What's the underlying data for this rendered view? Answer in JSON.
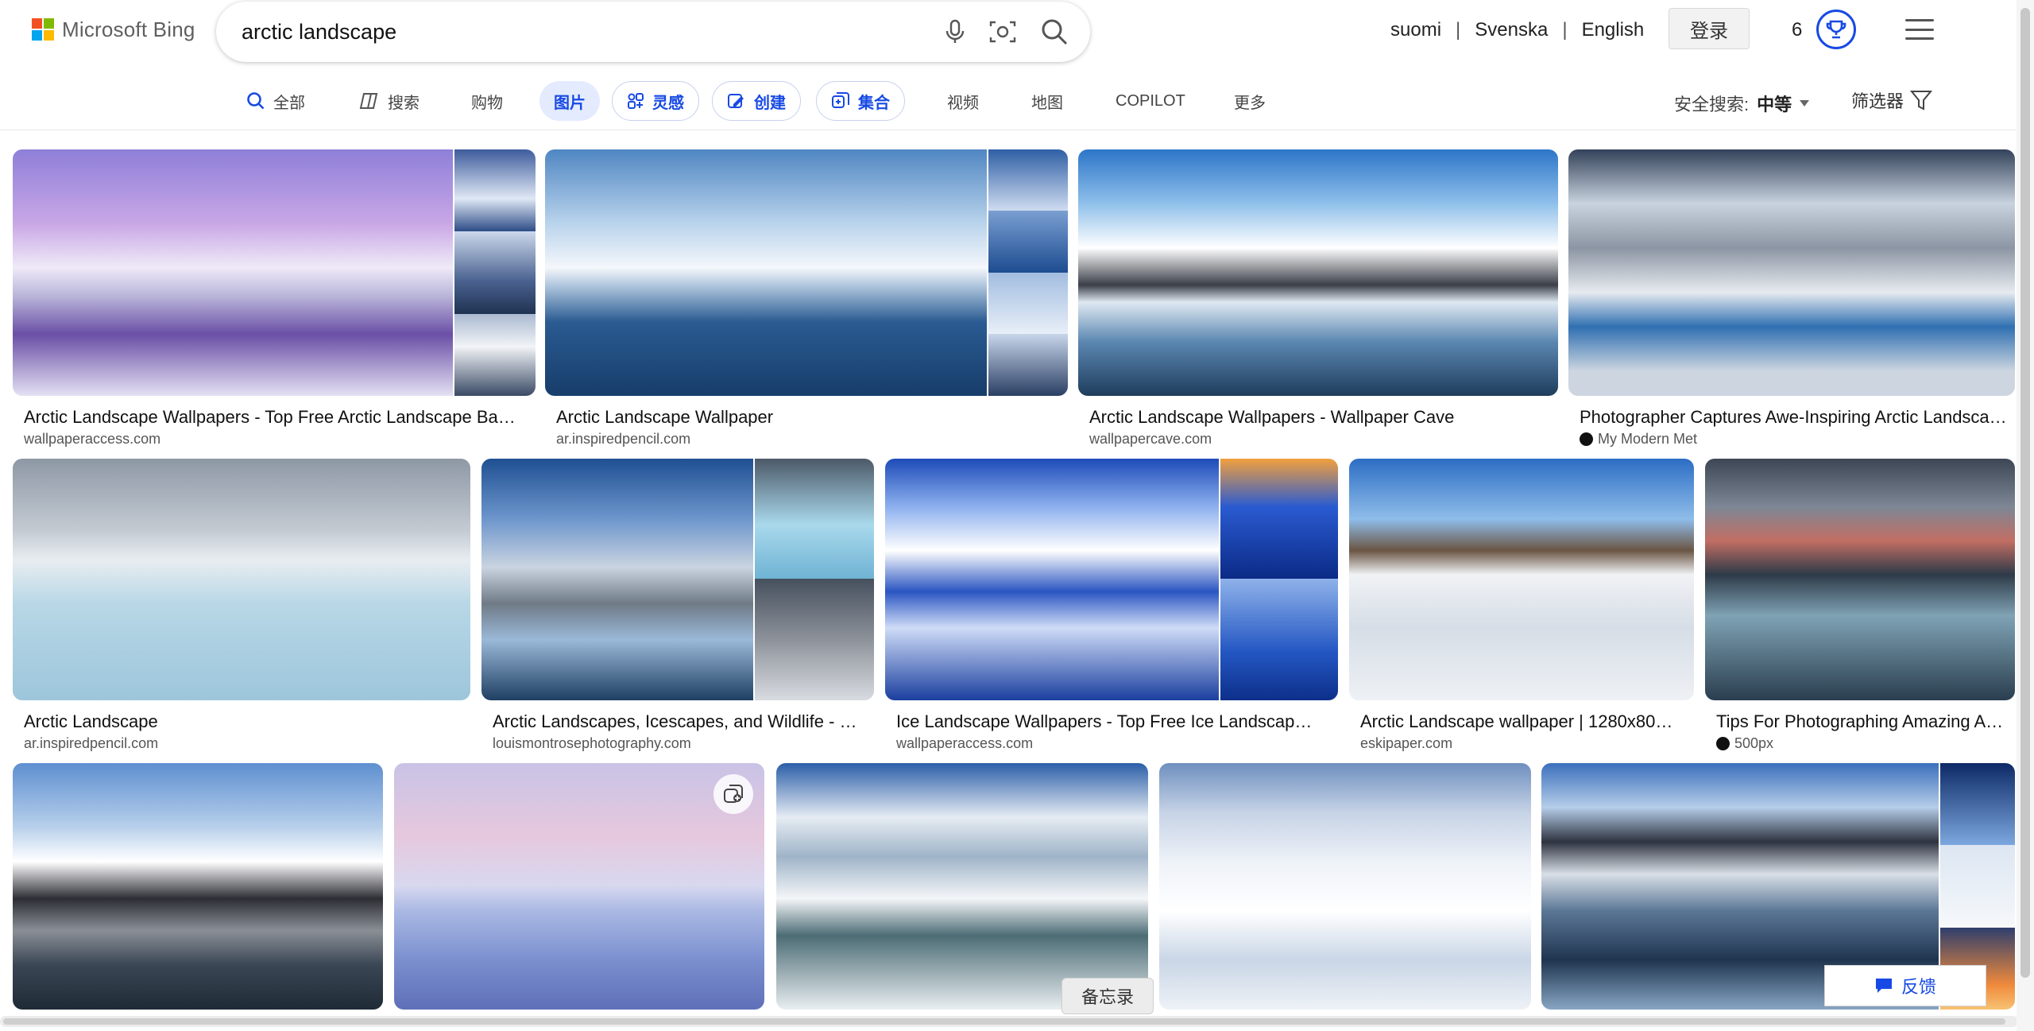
{
  "brand": {
    "name": "Microsoft Bing"
  },
  "search": {
    "query": "arctic landscape"
  },
  "header": {
    "languages": [
      "suomi",
      "Svenska",
      "English"
    ],
    "separator": "|",
    "login_label": "登录",
    "rewards_count": "6"
  },
  "nav": {
    "items": [
      {
        "label": "全部",
        "icon": "search-icon"
      },
      {
        "label": "搜索",
        "icon": "copilot-icon"
      },
      {
        "label": "购物"
      },
      {
        "label": "图片"
      },
      {
        "label": "灵感",
        "icon": "inspiration-icon"
      },
      {
        "label": "创建",
        "icon": "create-icon"
      },
      {
        "label": "集合",
        "icon": "collection-icon"
      },
      {
        "label": "视频"
      },
      {
        "label": "地图"
      },
      {
        "label": "COPILOT"
      },
      {
        "label": "更多"
      }
    ],
    "safe_search_label": "安全搜索:",
    "safe_search_value": "中等",
    "filter_label": "筛选器"
  },
  "results": [
    {
      "title": "Arctic Landscape Wallpapers - Top Free Arctic Landscape Ba…",
      "source": "wallpaperaccess.com"
    },
    {
      "title": "Arctic Landscape Wallpaper",
      "source": "ar.inspiredpencil.com"
    },
    {
      "title": "Arctic Landscape Wallpapers - Wallpaper Cave",
      "source": "wallpapercave.com"
    },
    {
      "title": "Photographer Captures Awe-Inspiring Arctic Landsca…",
      "source": "My Modern Met"
    },
    {
      "title": "Arctic Landscape",
      "source": "ar.inspiredpencil.com"
    },
    {
      "title": "Arctic Landscapes, Icescapes, and Wildlife - …",
      "source": "louismontrosephotography.com"
    },
    {
      "title": "Ice Landscape Wallpapers - Top Free Ice Landscap…",
      "source": "wallpaperaccess.com"
    },
    {
      "title": "Arctic Landscape wallpaper | 1280x80…",
      "source": "eskipaper.com"
    },
    {
      "title": "Tips For Photographing Amazing A…",
      "source": "500px"
    }
  ],
  "footer": {
    "memo_label": "备忘录",
    "feedback_label": "反馈"
  },
  "colors": {
    "accent": "#174ae4",
    "active_bg": "#e4ebff"
  }
}
